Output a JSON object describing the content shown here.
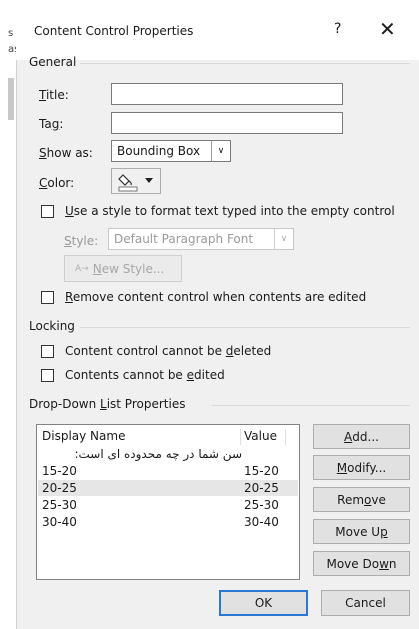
{
  "background": {
    "fragment_a": "s",
    "fragment_b": "as"
  },
  "dialog": {
    "title": "Content Control Properties",
    "help_glyph": "?",
    "close_glyph": "✕"
  },
  "general": {
    "heading": "General",
    "title_label_pre": "",
    "title_label_key": "T",
    "title_label_post": "itle:",
    "title_value": "",
    "tag_label_pre": "Ta",
    "tag_label_key": "g",
    "tag_label_post": ":",
    "tag_value": "",
    "showas_label_pre": "",
    "showas_label_key": "S",
    "showas_label_post": "how as:",
    "showas_value": "Bounding Box",
    "color_label_pre": "",
    "color_label_key": "C",
    "color_label_post": "olor:",
    "use_style_pre": "",
    "use_style_key": "U",
    "use_style_post": "se a style to format text typed into the empty control",
    "use_style_checked": false,
    "style_label_pre": "",
    "style_label_key": "S",
    "style_label_post": "tyle:",
    "style_value": "Default Paragraph Font",
    "new_style_pre": "",
    "new_style_key": "N",
    "new_style_post": "ew Style...",
    "remove_pre": "",
    "remove_key": "R",
    "remove_post": "emove content control when contents are edited",
    "remove_checked": false
  },
  "locking": {
    "heading": "Locking",
    "cannot_delete_pre": "Content control cannot be ",
    "cannot_delete_key": "d",
    "cannot_delete_post": "eleted",
    "cannot_delete_checked": false,
    "cannot_edit_pre": "Contents cannot be ",
    "cannot_edit_key": "e",
    "cannot_edit_post": "dited",
    "cannot_edit_checked": false
  },
  "dropdown": {
    "heading_pre": "Drop-Down ",
    "heading_key": "L",
    "heading_post": "ist Properties",
    "col_name": "Display Name",
    "col_value": "Value",
    "rows": [
      {
        "name": "سن شما در چه محدوده ای است:",
        "value": ""
      },
      {
        "name": "15-20",
        "value": "15-20"
      },
      {
        "name": "20-25",
        "value": "20-25"
      },
      {
        "name": "25-30",
        "value": "25-30"
      },
      {
        "name": "30-40",
        "value": "30-40"
      }
    ],
    "selected_row": 2,
    "add_pre": "",
    "add_key": "A",
    "add_post": "dd...",
    "modify_pre": "",
    "modify_key": "M",
    "modify_post": "odify...",
    "remove_pre": "Rem",
    "remove_key": "o",
    "remove_post": "ve",
    "moveup_pre": "Move U",
    "moveup_key": "p",
    "moveup_post": "",
    "movedown_pre": "Move Do",
    "movedown_key": "w",
    "movedown_post": "n"
  },
  "footer": {
    "ok": "OK",
    "cancel": "Cancel"
  },
  "colors": {
    "primary_border": "#2a78d4",
    "selected_row": "#e6e6e6"
  }
}
